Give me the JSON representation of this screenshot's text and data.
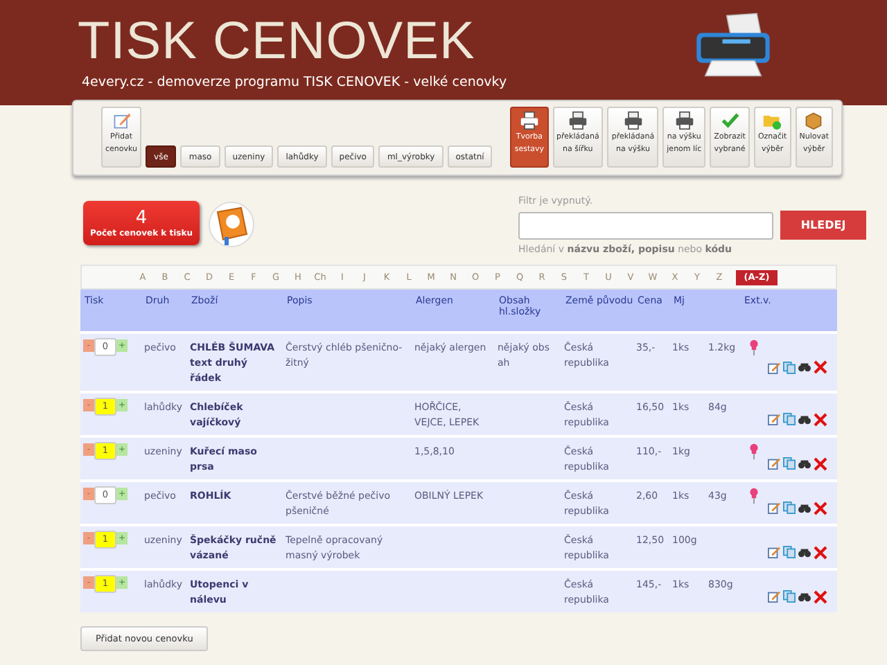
{
  "header": {
    "title": "TISK CENOVEK",
    "subtitle": "4every.cz - demoverze programu TISK CENOVEK - velké cenovky"
  },
  "toolbar": [
    {
      "kind": "action",
      "label": "Přidat\ncenovku",
      "selected": false
    },
    {
      "kind": "filter",
      "label": "vše",
      "selected": true
    },
    {
      "kind": "filter",
      "label": "maso",
      "selected": false
    },
    {
      "kind": "filter",
      "label": "uzeniny",
      "selected": false
    },
    {
      "kind": "filter",
      "label": "lahůdky",
      "selected": false
    },
    {
      "kind": "filter",
      "label": "pečivo",
      "selected": false
    },
    {
      "kind": "filter",
      "label": "ml_výrobky",
      "selected": false
    },
    {
      "kind": "filter",
      "label": "ostatní",
      "selected": false
    },
    {
      "kind": "action",
      "label": "Tvorba\nsestavy",
      "selected": true
    },
    {
      "kind": "action",
      "label": "překládaná\nna šířku",
      "selected": false
    },
    {
      "kind": "action",
      "label": "překládaná\nna výšku",
      "selected": false
    },
    {
      "kind": "action",
      "label": "na výšku\njenom líc",
      "selected": false
    },
    {
      "kind": "action",
      "label": "Zobrazit\nvybrané",
      "selected": false
    },
    {
      "kind": "action",
      "label": "Označit\nvýběr",
      "selected": false
    },
    {
      "kind": "action",
      "label": "Nulovat\nvýběr",
      "selected": false
    }
  ],
  "counter": {
    "count": "4",
    "label": "Počet cenovek k tisku"
  },
  "search": {
    "status": "Filtr je vypnutý.",
    "button": "HLEDEJ",
    "hint": "Hledání v **názvu zboží, popisu** nebo **kódu**"
  },
  "alphabet": [
    {
      "label": "A",
      "selected": false
    },
    {
      "label": "B",
      "selected": false
    },
    {
      "label": "C",
      "selected": false
    },
    {
      "label": "D",
      "selected": false
    },
    {
      "label": "E",
      "selected": false
    },
    {
      "label": "F",
      "selected": false
    },
    {
      "label": "G",
      "selected": false
    },
    {
      "label": "H",
      "selected": false
    },
    {
      "label": "Ch",
      "selected": false
    },
    {
      "label": "I",
      "selected": false
    },
    {
      "label": "J",
      "selected": false
    },
    {
      "label": "K",
      "selected": false
    },
    {
      "label": "L",
      "selected": false
    },
    {
      "label": "M",
      "selected": false
    },
    {
      "label": "N",
      "selected": false
    },
    {
      "label": "O",
      "selected": false
    },
    {
      "label": "P",
      "selected": false
    },
    {
      "label": "Q",
      "selected": false
    },
    {
      "label": "R",
      "selected": false
    },
    {
      "label": "S",
      "selected": false
    },
    {
      "label": "T",
      "selected": false
    },
    {
      "label": "U",
      "selected": false
    },
    {
      "label": "V",
      "selected": false
    },
    {
      "label": "W",
      "selected": false
    },
    {
      "label": "X",
      "selected": false
    },
    {
      "label": "Y",
      "selected": false
    },
    {
      "label": "Z",
      "selected": false
    },
    {
      "label": "(A-Z)",
      "selected": true
    }
  ],
  "table": {
    "columns": [
      "Tisk",
      "Druh",
      "Zboží",
      "Popis",
      "Alergen",
      "Obsah hl.složky",
      "Země původu",
      "Cena",
      "Mj",
      "Ext.v."
    ],
    "rows": [
      {
        "minus": "-",
        "qty": "0",
        "plus": "+",
        "highlighted": false,
        "druh": "pečivo",
        "zbozi": "CHLÉB ŠUMAVA text druhý řádek",
        "popis": "Čerstvý chléb pšenično-žitný",
        "alergen": "nějaký alergen",
        "obsah": "nějaký obs ah",
        "zeme": "Česká republika",
        "cena": "35,-",
        "mj": "1ks",
        "column_10": "1.2kg",
        "pinned": true
      },
      {
        "minus": "-",
        "qty": "1",
        "plus": "+",
        "highlighted": true,
        "druh": "lahůdky",
        "zbozi": "Chlebíček vajíčkový",
        "popis": "",
        "alergen": "HOŘČICE, VEJCE, LEPEK",
        "obsah": "",
        "zeme": "Česká republika",
        "cena": "16,50",
        "mj": "1ks",
        "column_10": "84g",
        "pinned": false
      },
      {
        "minus": "-",
        "qty": "1",
        "plus": "+",
        "highlighted": true,
        "druh": "uzeniny",
        "zbozi": "Kuřecí maso prsa",
        "popis": "",
        "alergen": "1,5,8,10",
        "obsah": "",
        "zeme": "Česká republika",
        "cena": "110,-",
        "mj": "1kg",
        "column_10": "",
        "pinned": true
      },
      {
        "minus": "-",
        "qty": "0",
        "plus": "+",
        "highlighted": false,
        "druh": "pečivo",
        "zbozi": "ROHLÍK",
        "popis": "Čerstvé běžné pečivo pšeničné",
        "alergen": "OBILNÝ LEPEK",
        "obsah": "",
        "zeme": "Česká republika",
        "cena": "2,60",
        "mj": "1ks",
        "column_10": "43g",
        "pinned": true
      },
      {
        "minus": "-",
        "qty": "1",
        "plus": "+",
        "highlighted": true,
        "druh": "uzeniny",
        "zbozi": "Špekáčky ručně vázané",
        "popis": "Tepelně opracovaný masný výrobek",
        "alergen": "",
        "obsah": "",
        "zeme": "Česká republika",
        "cena": "12,50",
        "mj": "100g",
        "column_10": "",
        "pinned": false
      },
      {
        "minus": "-",
        "qty": "1",
        "plus": "+",
        "highlighted": true,
        "druh": "lahůdky",
        "zbozi": "Utopenci v nálevu",
        "popis": "",
        "alergen": "",
        "obsah": "",
        "zeme": "Česká republika",
        "cena": "145,-",
        "mj": "1ks",
        "column_10": "830g",
        "pinned": false
      }
    ]
  },
  "add_button": "Přidat novou cenovku"
}
